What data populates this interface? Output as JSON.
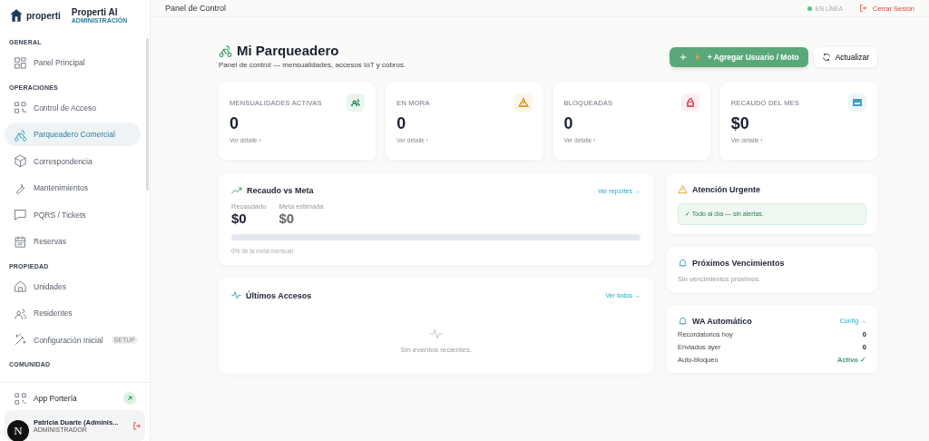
{
  "brand": {
    "logo_text": "properti",
    "title": "Properti AI",
    "subtitle": "ADMINISTRACIÓN"
  },
  "sidebar": {
    "sections": [
      {
        "title": "GENERAL",
        "items": [
          {
            "label": "Panel Principal",
            "selected": false
          }
        ]
      },
      {
        "title": "OPERACIONES",
        "items": [
          {
            "label": "Control de Acceso",
            "selected": false
          },
          {
            "label": "Parqueadero Comercial",
            "selected": true
          },
          {
            "label": "Correspondencia",
            "selected": false
          },
          {
            "label": "Mantenimientos",
            "selected": false
          },
          {
            "label": "PQRS / Tickets",
            "selected": false
          },
          {
            "label": "Reservas",
            "selected": false
          }
        ]
      },
      {
        "title": "PROPIEDAD",
        "items": [
          {
            "label": "Unidades",
            "selected": false
          },
          {
            "label": "Residentes",
            "selected": false
          },
          {
            "label": "Configuración Inicial",
            "selected": false,
            "badge": "SETUP"
          }
        ]
      },
      {
        "title": "COMUNIDAD"
      }
    ],
    "footer_link": "App Portería",
    "user": {
      "avatar": "N",
      "name": "Patricia Duarte (Adminis...",
      "role": "ADMINISTRADOR"
    }
  },
  "topbar": {
    "title": "Panel de Control",
    "status": "EN LÍNEA",
    "online": true,
    "logout": "Cerrar Sesión"
  },
  "header": {
    "title": "Mi Parqueadero",
    "subtitle": "Panel de control — mensualidades, accesos IoT y cobros.",
    "primary_button": "+ Agregar Usuario / Moto",
    "secondary_button": "Actualizar"
  },
  "stats": [
    {
      "label": "MENSUALIDADES ACTIVAS",
      "value": "0",
      "link": "Ver detalle ›",
      "color": "#3f9a6a"
    },
    {
      "label": "EN MORA",
      "value": "0",
      "link": "Ver detalle ›",
      "color": "#e0a030"
    },
    {
      "label": "BLOQUEADAS",
      "value": "0",
      "link": "Ver detalle ›",
      "color": "#e05a6a"
    },
    {
      "label": "RECAUDO DEL MES",
      "value": "$0",
      "link": "Ver detalle ›",
      "color": "#3fa0c0"
    }
  ],
  "revenue": {
    "title": "Recaudo vs Meta",
    "link": "Ver reportes →",
    "collected_label": "Recaudado",
    "collected": "$0",
    "goal_label": "Meta estimada",
    "goal": "$0",
    "level": 0,
    "note": "0% de la meta mensual"
  },
  "accesses": {
    "title": "Últimos Accesos",
    "link": "Ver todos →",
    "empty": "Sin eventos recientes."
  },
  "urgent": {
    "title": "Atención Urgente",
    "message": "✓ Todo al día — sin alertas."
  },
  "expirations": {
    "title": "Próximos Vencimientos",
    "empty": "Sin vencimientos próximos."
  },
  "wa": {
    "title": "WA Automático",
    "link": "Config →",
    "rows": [
      {
        "label": "Recordatorios hoy",
        "value": "0",
        "active": false
      },
      {
        "label": "Enviados ayer",
        "value": "0",
        "active": false
      },
      {
        "label": "Auto-bloqueo",
        "value": "Activo ✓",
        "active": true
      }
    ]
  }
}
